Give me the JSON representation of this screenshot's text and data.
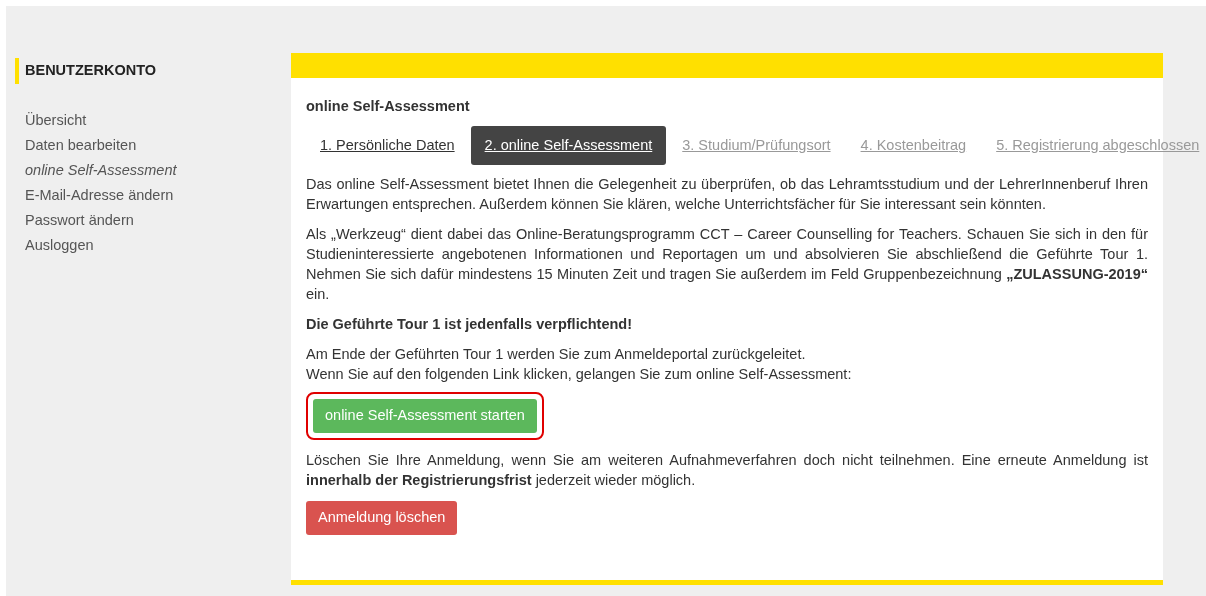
{
  "sidebar": {
    "title": "BENUTZERKONTO",
    "items": [
      {
        "label": "Übersicht",
        "selected": false
      },
      {
        "label": "Daten bearbeiten",
        "selected": false
      },
      {
        "label": "online Self-Assessment",
        "selected": true
      },
      {
        "label": "E-Mail-Adresse ändern",
        "selected": false
      },
      {
        "label": "Passwort ändern",
        "selected": false
      },
      {
        "label": "Ausloggen",
        "selected": false
      }
    ]
  },
  "main": {
    "heading": "online Self-Assessment",
    "steps": [
      {
        "label": "1. Persönliche Daten",
        "selected": false,
        "disabled": false
      },
      {
        "label": "2. online Self-Assessment",
        "selected": true,
        "disabled": false
      },
      {
        "label": "3. Studium/Prüfungsort",
        "selected": false,
        "disabled": true
      },
      {
        "label": "4. Kostenbeitrag",
        "selected": false,
        "disabled": true
      },
      {
        "label": "5. Registrierung abgeschlossen",
        "selected": false,
        "disabled": true
      }
    ],
    "paragraphs": [
      "Das online Self-Assessment bietet Ihnen die Gelegenheit zu überprüfen, ob das Lehramtsstudium und der LehrerInnenberuf Ihren Erwartungen entsprechen. Außerdem können Sie klären, welche Unterrichtsfächer für Sie interessant sein könnten.",
      "Als „Werkzeug“ dient dabei das Online-Beratungsprogramm CCT – Career Counselling for Teachers. Schauen Sie sich in den für Studieninteressierte angebotenen Informationen und Reportagen um und absolvieren Sie abschließend die Geführte Tour 1. Nehmen Sie sich dafür mindestens 15 Minuten Zeit und tragen Sie außerdem im Feld Gruppenbezeichnung **„ZULASSUNG-2019“** ein.",
      "**Die Geführte Tour 1 ist jedenfalls verpflichtend!**",
      "Am Ende der Geführten Tour 1 werden Sie zum Anmeldeportal zurückgeleitet.\nWenn Sie auf den folgenden Link klicken, gelangen Sie zum online Self-Assessment:"
    ],
    "start_button": {
      "label": "online Self-Assessment starten",
      "highlighted": true
    },
    "delete_text": "Löschen Sie Ihre Anmeldung, wenn Sie am weiteren Aufnahmeverfahren doch nicht teilnehmen. Eine erneute Anmeldung ist **innerhalb der Registrierungsfrist** jederzeit wieder möglich.",
    "delete_button": {
      "label": "Anmeldung löschen"
    }
  }
}
